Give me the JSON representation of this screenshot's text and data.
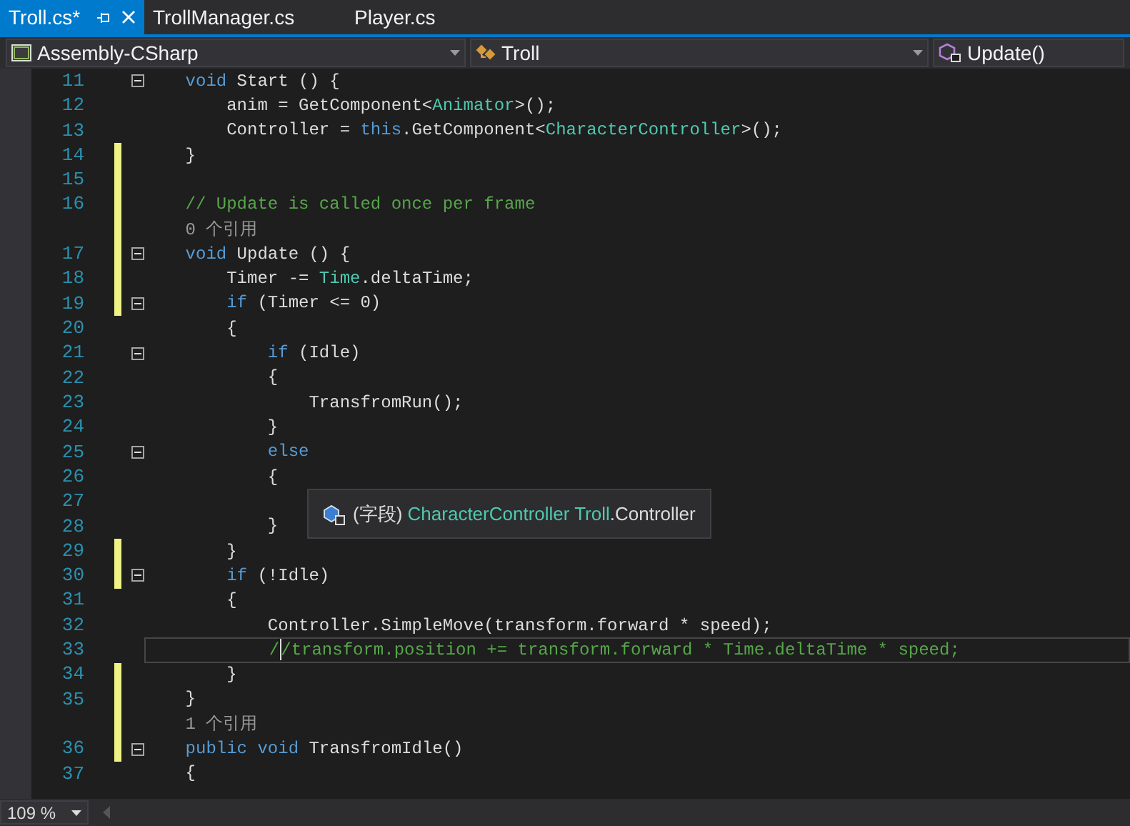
{
  "tabs": [
    {
      "label": "Troll.cs*",
      "selected": true
    },
    {
      "label": "TrollManager.cs",
      "selected": false
    },
    {
      "label": "Player.cs",
      "selected": false
    }
  ],
  "navigation": [
    {
      "kind": "project",
      "label": "Assembly-CSharp"
    },
    {
      "kind": "class",
      "label": "Troll"
    },
    {
      "kind": "method",
      "label": "Update()"
    }
  ],
  "lines": [
    {
      "number": "11",
      "fold": true,
      "changed": false,
      "tokens": [
        {
          "kind": "kw",
          "t": "    void"
        },
        {
          "kind": "p",
          "t": " Start () {"
        }
      ]
    },
    {
      "number": "12",
      "fold": false,
      "changed": false,
      "tokens": [
        {
          "kind": "p",
          "t": "        anim = GetComponent<"
        },
        {
          "kind": "type",
          "t": "Animator"
        },
        {
          "kind": "p",
          "t": ">();"
        }
      ]
    },
    {
      "number": "13",
      "fold": false,
      "changed": false,
      "tokens": [
        {
          "kind": "p",
          "t": "        Controller = "
        },
        {
          "kind": "kw",
          "t": "this"
        },
        {
          "kind": "p",
          "t": ".GetComponent<"
        },
        {
          "kind": "type",
          "t": "CharacterController"
        },
        {
          "kind": "p",
          "t": ">();"
        }
      ]
    },
    {
      "number": "14",
      "fold": false,
      "changed": true,
      "tokens": [
        {
          "kind": "p",
          "t": "    }"
        }
      ]
    },
    {
      "number": "15",
      "fold": false,
      "changed": true
    },
    {
      "number": "16",
      "fold": false,
      "changed": true,
      "tokens": [
        {
          "kind": "comment",
          "t": "    // Update is called once per frame"
        }
      ]
    },
    {
      "kind": "codelens",
      "changed": true,
      "text": "    0 个引用"
    },
    {
      "number": "17",
      "fold": true,
      "changed": true,
      "tokens": [
        {
          "kind": "kw",
          "t": "    void"
        },
        {
          "kind": "p",
          "t": " Update () {"
        }
      ]
    },
    {
      "number": "18",
      "fold": false,
      "changed": true,
      "tokens": [
        {
          "kind": "p",
          "t": "        Timer -= "
        },
        {
          "kind": "type",
          "t": "Time"
        },
        {
          "kind": "p",
          "t": ".deltaTime;"
        }
      ]
    },
    {
      "number": "19",
      "fold": true,
      "changed": true,
      "tokens": [
        {
          "kind": "kw",
          "t": "        if"
        },
        {
          "kind": "p",
          "t": " (Timer <= 0)"
        }
      ]
    },
    {
      "number": "20",
      "fold": false,
      "changed": false,
      "tokens": [
        {
          "kind": "p",
          "t": "        {"
        }
      ]
    },
    {
      "number": "21",
      "fold": true,
      "changed": false,
      "tokens": [
        {
          "kind": "kw",
          "t": "            if"
        },
        {
          "kind": "p",
          "t": " (Idle)"
        }
      ]
    },
    {
      "number": "22",
      "fold": false,
      "changed": false,
      "tokens": [
        {
          "kind": "p",
          "t": "            {"
        }
      ]
    },
    {
      "number": "23",
      "fold": false,
      "changed": false,
      "tokens": [
        {
          "kind": "p",
          "t": "                TransfromRun();"
        }
      ]
    },
    {
      "number": "24",
      "fold": false,
      "changed": false,
      "tokens": [
        {
          "kind": "p",
          "t": "            }"
        }
      ]
    },
    {
      "number": "25",
      "fold": true,
      "changed": false,
      "tokens": [
        {
          "kind": "kw",
          "t": "            else"
        }
      ]
    },
    {
      "number": "26",
      "fold": false,
      "changed": false,
      "tokens": [
        {
          "kind": "p",
          "t": "            {"
        }
      ]
    },
    {
      "number": "27",
      "fold": false,
      "changed": false
    },
    {
      "number": "28",
      "fold": false,
      "changed": false,
      "tokens": [
        {
          "kind": "p",
          "t": "            }"
        }
      ]
    },
    {
      "number": "29",
      "fold": false,
      "changed": true,
      "tokens": [
        {
          "kind": "p",
          "t": "        }"
        }
      ]
    },
    {
      "number": "30",
      "fold": true,
      "changed": true,
      "tokens": [
        {
          "kind": "kw",
          "t": "        if"
        },
        {
          "kind": "p",
          "t": " (!Idle)"
        }
      ]
    },
    {
      "number": "31",
      "fold": false,
      "changed": false,
      "tokens": [
        {
          "kind": "p",
          "t": "        {"
        }
      ]
    },
    {
      "number": "32",
      "fold": false,
      "changed": false,
      "tokens": [
        {
          "kind": "p",
          "t": "            Controller.SimpleMove(transform.forward * speed);"
        }
      ]
    },
    {
      "number": "33",
      "fold": false,
      "changed": false,
      "current": true,
      "tokens": [
        {
          "kind": "comment",
          "t": "            /"
        },
        {
          "kind": "comment",
          "t": "/transform.position += transform.forward * Time.deltaTime * speed;"
        }
      ]
    },
    {
      "number": "34",
      "fold": false,
      "changed": true,
      "tokens": [
        {
          "kind": "p",
          "t": "        }"
        }
      ]
    },
    {
      "number": "35",
      "fold": false,
      "changed": true,
      "tokens": [
        {
          "kind": "p",
          "t": "    }"
        }
      ]
    },
    {
      "kind": "codelens",
      "changed": true,
      "text": "    1 个引用"
    },
    {
      "number": "36",
      "fold": true,
      "changed": true,
      "tokens": [
        {
          "kind": "kw",
          "t": "    public"
        },
        {
          "kind": "kw",
          "t": " void"
        },
        {
          "kind": "p",
          "t": " TransfromIdle()"
        }
      ]
    },
    {
      "number": "37",
      "fold": false,
      "changed": false,
      "tokens": [
        {
          "kind": "p",
          "t": "    {"
        }
      ]
    }
  ],
  "tooltip": {
    "parts": [
      {
        "kind": "p",
        "t": "(字段) "
      },
      {
        "kind": "type",
        "t": "CharacterController Troll"
      },
      {
        "kind": "p",
        "t": ".Controller"
      }
    ]
  },
  "zoom": {
    "value": "109 %"
  }
}
